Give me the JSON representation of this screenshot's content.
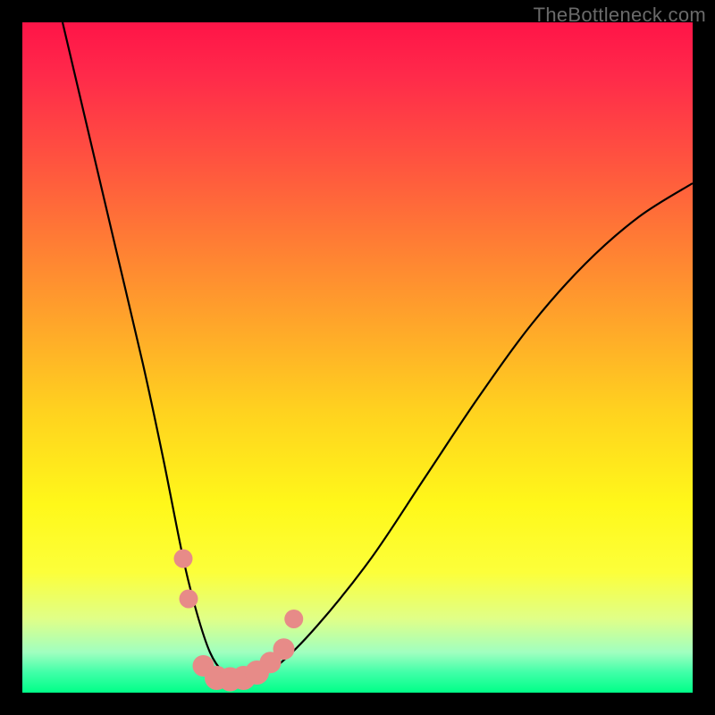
{
  "watermark": "TheBottleneck.com",
  "chart_data": {
    "type": "line",
    "title": "",
    "xlabel": "",
    "ylabel": "",
    "xlim": [
      0,
      100
    ],
    "ylim": [
      0,
      100
    ],
    "series": [
      {
        "name": "bottleneck-curve",
        "x": [
          6,
          10,
          14,
          18,
          21,
          24,
          26,
          28,
          30,
          32,
          34,
          38,
          44,
          52,
          60,
          68,
          76,
          84,
          92,
          100
        ],
        "values": [
          100,
          83,
          66,
          49,
          35,
          20,
          12,
          6,
          3,
          2,
          2,
          4,
          10,
          20,
          32,
          44,
          55,
          64,
          71,
          76
        ]
      }
    ],
    "markers": {
      "name": "highlight-points",
      "color": "#e78b88",
      "points": [
        {
          "x": 24.0,
          "y": 20.0,
          "r": 1.4
        },
        {
          "x": 24.8,
          "y": 14.0,
          "r": 1.4
        },
        {
          "x": 27.0,
          "y": 4.0,
          "r": 1.6
        },
        {
          "x": 29.0,
          "y": 2.2,
          "r": 1.8
        },
        {
          "x": 31.0,
          "y": 2.0,
          "r": 1.8
        },
        {
          "x": 33.0,
          "y": 2.2,
          "r": 1.8
        },
        {
          "x": 35.0,
          "y": 3.0,
          "r": 1.8
        },
        {
          "x": 37.0,
          "y": 4.5,
          "r": 1.6
        },
        {
          "x": 39.0,
          "y": 6.5,
          "r": 1.6
        },
        {
          "x": 40.5,
          "y": 11.0,
          "r": 1.4
        }
      ]
    }
  }
}
